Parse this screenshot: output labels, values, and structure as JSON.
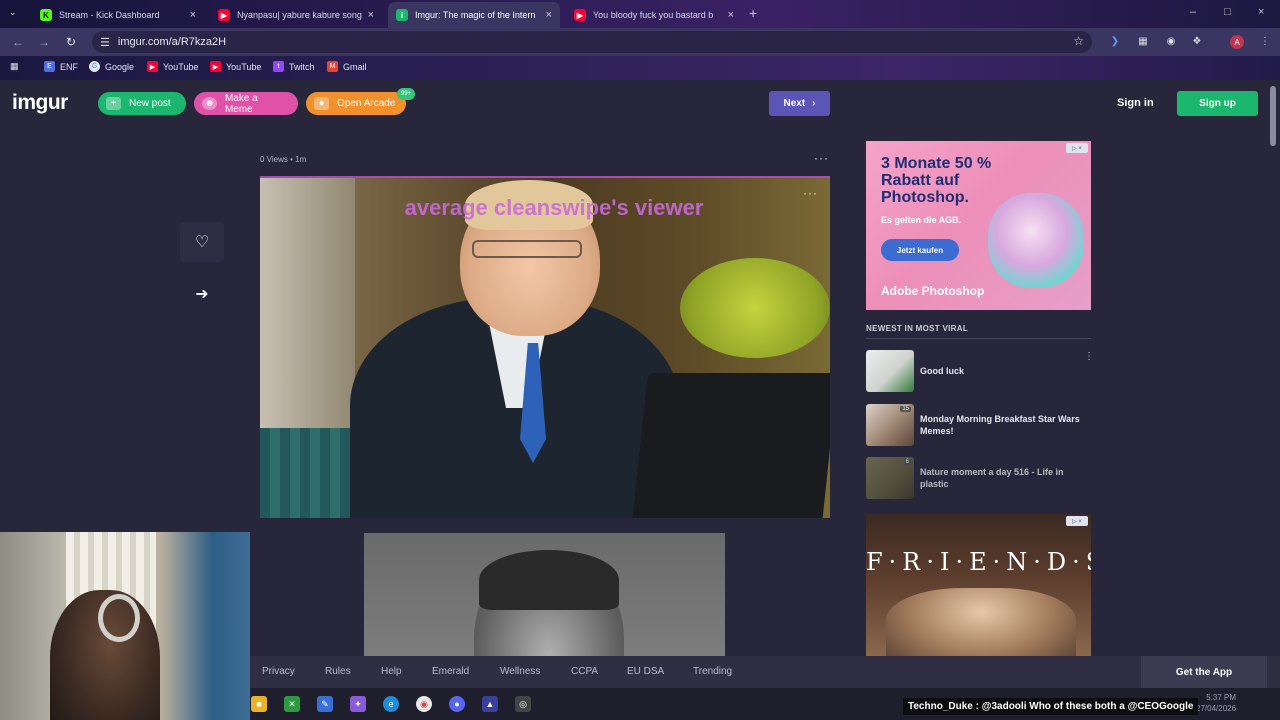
{
  "browser": {
    "tabs": [
      {
        "title": "Stream - Kick Dashboard",
        "favicon": "kick-icon",
        "color": "#53fc18"
      },
      {
        "title": "Nyanpasu| yabure kabure song",
        "favicon": "youtube-icon",
        "color": "#ff0033"
      },
      {
        "title": "Imgur: The magic of the Intern",
        "favicon": "imgur-icon",
        "color": "#1bb76e"
      },
      {
        "title": "You bloody fuck you bastard b",
        "favicon": "youtube-icon",
        "color": "#ff0033"
      }
    ],
    "url": "imgur.com/a/R7kza2H",
    "bookmarks": [
      {
        "label": "ENF",
        "icon": "enf-icon",
        "color": "#4f6fd8"
      },
      {
        "label": "Google",
        "icon": "google-icon",
        "color": "#e7e7e7"
      },
      {
        "label": "YouTube",
        "icon": "youtube-icon",
        "color": "#ff0033"
      },
      {
        "label": "YouTube",
        "icon": "youtube-icon",
        "color": "#ff0033"
      },
      {
        "label": "Twitch",
        "icon": "twitch-icon",
        "color": "#9146ff"
      },
      {
        "label": "Gmail",
        "icon": "gmail-icon",
        "color": "#ea4335"
      }
    ],
    "profile_initial": "A"
  },
  "header": {
    "logo": "imgur",
    "new_post": "New post",
    "make_meme": "Make a Meme",
    "open_arcade": "Open Arcade",
    "arcade_badge": "99+",
    "next": "Next",
    "sign_in": "Sign in",
    "sign_up": "Sign up"
  },
  "post": {
    "meta": "0 Views • 1m",
    "caption": "average cleanswipe's viewer"
  },
  "ads": {
    "ad1_headline": "3 Monate 50 % Rabatt auf Photoshop.",
    "ad1_sub": "Es gelten die AGB.",
    "ad1_cta": "Jetzt kaufen",
    "ad1_brand": "Adobe Photoshop",
    "ad2_logo": "F·R·I·E·N·D·S"
  },
  "viral": {
    "heading": "NEWEST IN MOST VIRAL",
    "items": [
      {
        "title": "Good luck",
        "count": ""
      },
      {
        "title": "Monday Morning Breakfast Star Wars Memes!",
        "count": "15"
      },
      {
        "title": "Nature moment a day 516 - Life in plastic",
        "count": "6"
      }
    ]
  },
  "footer": {
    "links": [
      "Privacy",
      "Rules",
      "Help",
      "Emerald",
      "Wellness",
      "CCPA",
      "EU DSA",
      "Trending"
    ],
    "get_app": "Get the App"
  },
  "overlay": {
    "chat_message": "Techno_Duke : @3adooli Who of these both a @CEOGoogle",
    "clock_time": "5:37 PM",
    "clock_date": "27/04/2026"
  },
  "colors": {
    "page_bg": "#27263a",
    "new_post_green": "#1bb76e",
    "meme_pink": "#e052a8",
    "arcade_orange": "#f2912b",
    "next_purple": "#5c55b8"
  }
}
